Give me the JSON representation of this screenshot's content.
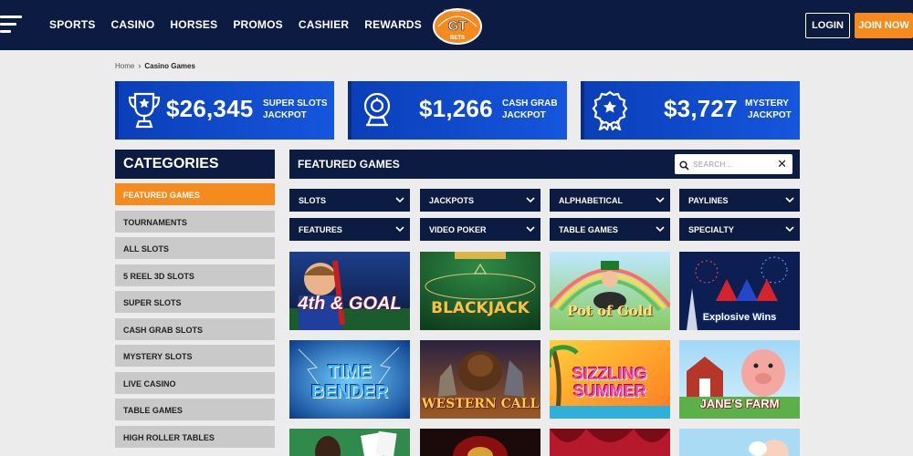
{
  "header": {
    "nav": [
      "SPORTS",
      "CASINO",
      "HORSES",
      "PROMOS",
      "CASHIER",
      "REWARDS"
    ],
    "logo": {
      "top_text": "IT'S GAME TIME",
      "mark": "GT",
      "sub": "BETS"
    },
    "login": "LOGIN",
    "join": "JOIN NOW",
    "colors": {
      "navy": "#0c1b41",
      "orange": "#f58a1f",
      "jackpot_blue": "#1556de"
    }
  },
  "breadcrumb": {
    "home": "Home",
    "current": "Casino Games"
  },
  "jackpots": [
    {
      "amount": "$26,345",
      "line1": "SUPER SLOTS",
      "line2": "JACKPOT",
      "icon": "trophy-icon"
    },
    {
      "amount": "$1,266",
      "line1": "CASH GRAB",
      "line2": "JACKPOT",
      "icon": "claw-machine-icon"
    },
    {
      "amount": "$3,727",
      "line1": "MYSTERY",
      "line2": "JACKPOT",
      "icon": "award-ribbon-icon"
    }
  ],
  "categories": {
    "title": "CATEGORIES",
    "items": [
      "FEATURED GAMES",
      "TOURNAMENTS",
      "ALL SLOTS",
      "5 REEL 3D SLOTS",
      "SUPER SLOTS",
      "CASH GRAB SLOTS",
      "MYSTERY SLOTS",
      "LIVE CASINO",
      "TABLE GAMES",
      "HIGH ROLLER TABLES"
    ],
    "active_index": 0
  },
  "main": {
    "title": "FEATURED GAMES",
    "search_placeholder": "SEARCH...",
    "filters": [
      "SLOTS",
      "JACKPOTS",
      "ALPHABETICAL",
      "PAYLINES",
      "FEATURES",
      "VIDEO POKER",
      "TABLE GAMES",
      "SPECIALTY"
    ]
  },
  "games": [
    {
      "title": "4th & GOAL"
    },
    {
      "title": "BLACKJACK"
    },
    {
      "title": "Pot of Gold"
    },
    {
      "title": "Explosive Wins"
    },
    {
      "title": "TIME BENDER"
    },
    {
      "title": "WESTERN CALL"
    },
    {
      "title": "SIZZLING SUMMER"
    },
    {
      "title": "JANE'S FARM"
    }
  ]
}
